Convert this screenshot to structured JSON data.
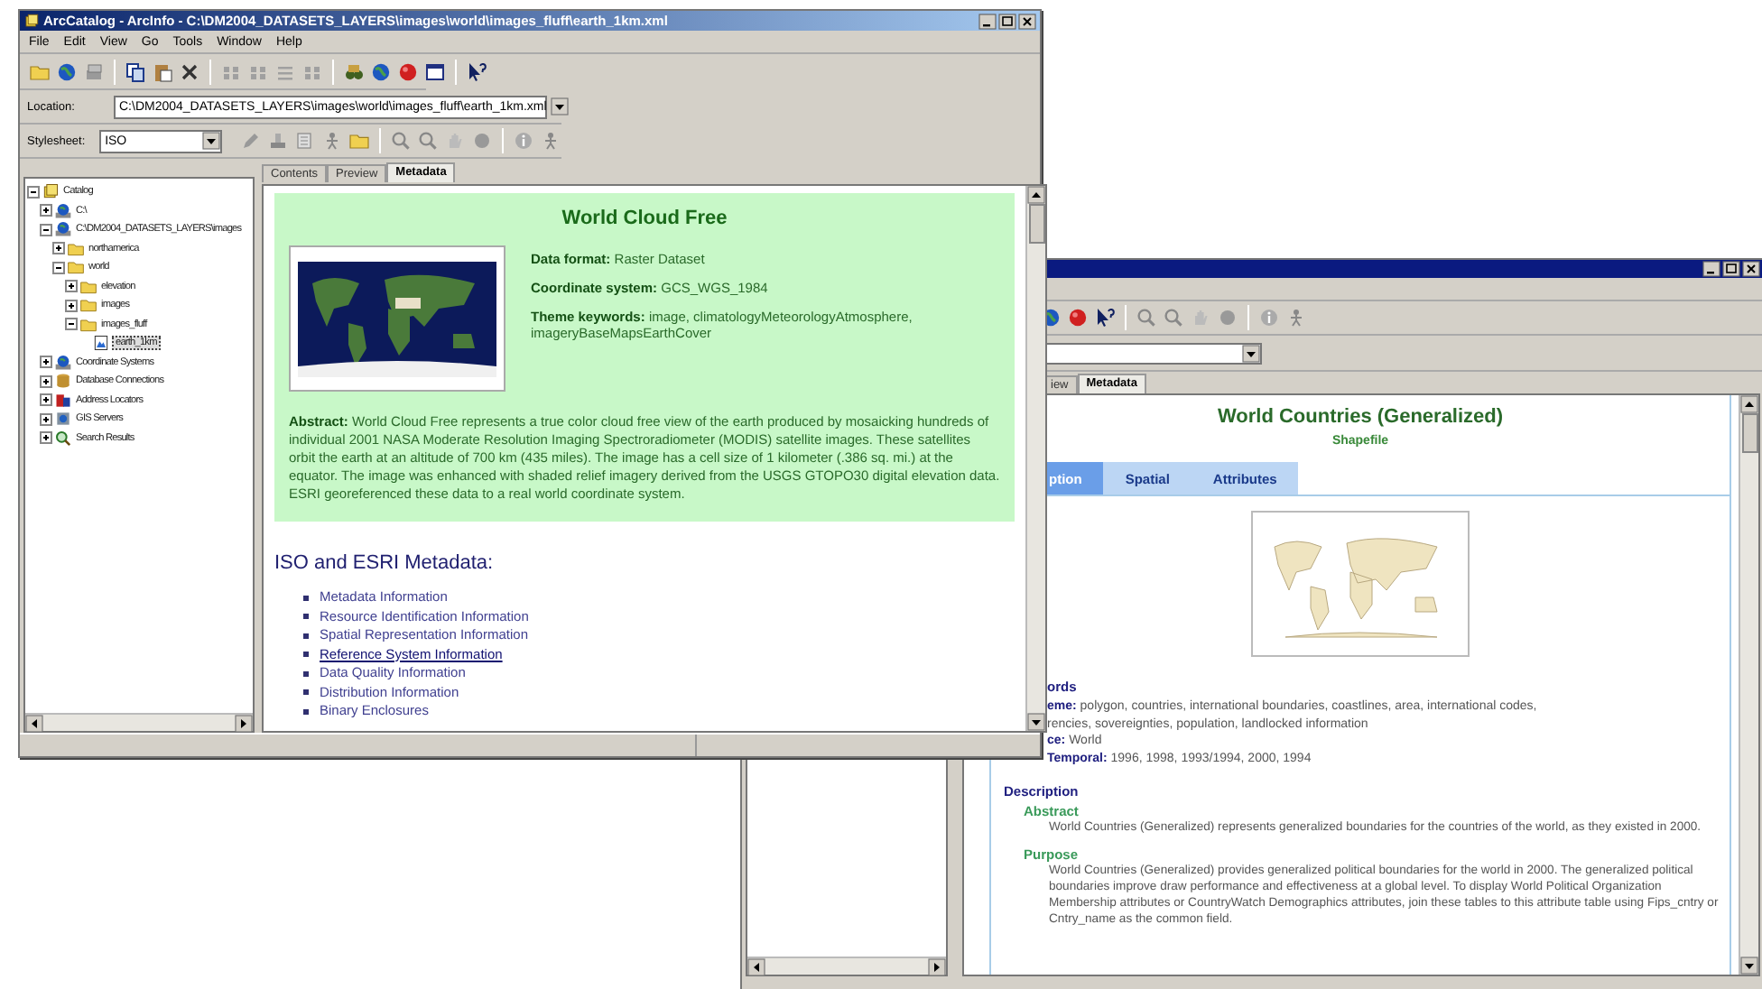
{
  "front_window": {
    "title": "ArcCatalog - ArcInfo - C:\\DM2004_DATASETS_LAYERS\\images\\world\\images_fluff\\earth_1km.xml",
    "menu": [
      "File",
      "Edit",
      "View",
      "Go",
      "Tools",
      "Window",
      "Help"
    ],
    "location": {
      "label": "Location:",
      "value": "C:\\DM2004_DATASETS_LAYERS\\images\\world\\images_fluff\\earth_1km.xml"
    },
    "stylesheet": {
      "label": "Stylesheet:",
      "value": "ISO"
    },
    "tree": [
      {
        "label": "Catalog",
        "kind": "catalog",
        "selected": false,
        "expanded": true,
        "children": [
          {
            "label": "C:\\",
            "kind": "drive",
            "selected": false,
            "expanded": false
          },
          {
            "label": "C:\\DM2004_DATASETS_LAYERS\\images",
            "kind": "drive",
            "selected": false,
            "expanded": true,
            "children": [
              {
                "label": "northamerica",
                "kind": "folder",
                "selected": false,
                "expanded": false
              },
              {
                "label": "world",
                "kind": "folder",
                "selected": false,
                "expanded": true,
                "children": [
                  {
                    "label": "elevation",
                    "kind": "folder",
                    "selected": false,
                    "expanded": false
                  },
                  {
                    "label": "images",
                    "kind": "folder",
                    "selected": false,
                    "expanded": false
                  },
                  {
                    "label": "images_fluff",
                    "kind": "folder",
                    "selected": false,
                    "expanded": true,
                    "children": [
                      {
                        "label": "earth_1km",
                        "kind": "raster",
                        "selected": true
                      }
                    ]
                  }
                ]
              }
            ]
          },
          {
            "label": "Coordinate Systems",
            "kind": "drive",
            "selected": false,
            "expanded": false
          },
          {
            "label": "Database Connections",
            "kind": "connections",
            "selected": false,
            "expanded": false
          },
          {
            "label": "Address Locators",
            "kind": "address",
            "selected": false,
            "expanded": false
          },
          {
            "label": "GIS Servers",
            "kind": "server",
            "selected": false,
            "expanded": false
          },
          {
            "label": "Search Results",
            "kind": "search",
            "selected": false,
            "expanded": false
          }
        ]
      }
    ],
    "tabs": [
      {
        "label": "Contents",
        "selected": false
      },
      {
        "label": "Preview",
        "selected": false
      },
      {
        "label": "Metadata",
        "selected": true
      }
    ],
    "metadata": {
      "title": "World Cloud Free",
      "fields": [
        {
          "label": "Data format:",
          "value": "Raster Dataset"
        },
        {
          "label": "Coordinate system:",
          "value": "GCS_WGS_1984"
        },
        {
          "label": "Theme keywords:",
          "value": "image, climatologyMeteorologyAtmosphere, imageryBaseMapsEarthCover"
        }
      ],
      "abstract": {
        "label": "Abstract:",
        "text": "World Cloud Free represents a true color cloud free view of the earth produced by mosaicking hundreds of individual 2001 NASA Moderate Resolution Imaging Spectroradiometer (MODIS) satellite images. These satellites orbit the earth at an altitude of 700 km (435 miles). The image has a cell size of 1 kilometer (.386 sq. mi.) at the equator. The image was enhanced with shaded relief imagery derived from the USGS GTOPO30 digital elevation data. ESRI georeferenced these data to a real world coordinate system."
      },
      "section_heading": "ISO and ESRI Metadata:",
      "links": [
        {
          "label": "Metadata Information",
          "selected": false
        },
        {
          "label": "Resource Identification Information",
          "selected": false
        },
        {
          "label": "Spatial Representation Information",
          "selected": false
        },
        {
          "label": "Reference System Information",
          "selected": true
        },
        {
          "label": "Data Quality Information",
          "selected": false
        },
        {
          "label": "Distribution Information",
          "selected": false
        },
        {
          "label": "Binary Enclosures",
          "selected": false
        }
      ]
    }
  },
  "back_window": {
    "tabs": [
      {
        "label": "iew",
        "selected": false
      },
      {
        "label": "Metadata",
        "selected": true
      }
    ],
    "title": "World Countries (Generalized)",
    "subtitle": "Shapefile",
    "metadata_tabs": [
      {
        "label": "ption",
        "selected": true
      },
      {
        "label": "Spatial",
        "selected": false
      },
      {
        "label": "Attributes",
        "selected": false
      }
    ],
    "keywords_heading": "ords",
    "keywords": [
      {
        "label": "eme:",
        "lines": [
          "polygon, countries, international boundaries, coastlines, area, international codes,",
          "rencies, sovereignties, population, landlocked information"
        ]
      },
      {
        "label": "ce:",
        "lines": [
          "World"
        ]
      },
      {
        "label": "Temporal:",
        "lines": [
          "1996, 1998, 1993/1994, 2000, 1994"
        ]
      }
    ],
    "description": {
      "heading": "Description",
      "sections": [
        {
          "heading": "Abstract",
          "text": "World Countries (Generalized) represents generalized boundaries for the countries of the world, as they existed in 2000."
        },
        {
          "heading": "Purpose",
          "text": "World Countries (Generalized) provides generalized political boundaries for the world in 2000. The generalized political boundaries improve draw performance and effectiveness at a global level. To display World Political Organization Membership attributes or CountryWatch Demographics attributes, join these tables to this attribute table using Fips_cntry or Cntry_name as the common field."
        }
      ]
    }
  }
}
